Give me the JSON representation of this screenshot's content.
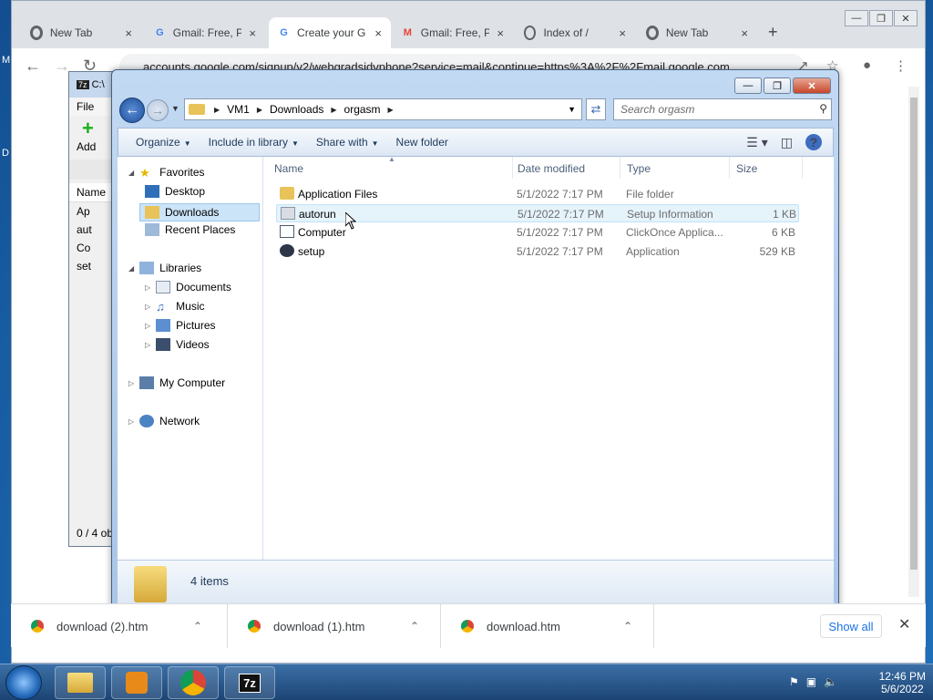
{
  "desktop": {
    "label_left_top": "M",
    "label_left_mid": "D"
  },
  "browser": {
    "tabs": [
      {
        "title": "New Tab",
        "icon": "chrome-icon"
      },
      {
        "title": "Gmail: Free, P",
        "icon": "google-icon"
      },
      {
        "title": "Create your G",
        "icon": "google-icon"
      },
      {
        "title": "Gmail: Free, P",
        "icon": "gmail-icon"
      },
      {
        "title": "Index of /",
        "icon": "globe-icon"
      },
      {
        "title": "New Tab",
        "icon": "chrome-icon"
      }
    ],
    "active_tab": 2,
    "new_tab_glyph": "+",
    "close_glyph": "×",
    "url": "accounts.google.com/signup/v2/webgradsidvphone?service=mail&continue=https%3A%2F%2Fmail.google.com"
  },
  "sevenzip": {
    "title": "C:\\",
    "menu_file": "File",
    "add_label": "Add",
    "col_name": "Name",
    "rows": [
      "Ap",
      "aut",
      "Co",
      "set"
    ],
    "status": "0 / 4 ob"
  },
  "explorer": {
    "breadcrumb": [
      "VM1",
      "Downloads",
      "orgasm"
    ],
    "search_placeholder": "Search orgasm",
    "commands": {
      "organize": "Organize",
      "include": "Include in library",
      "share": "Share with",
      "new_folder": "New folder"
    },
    "nav": {
      "favorites": "Favorites",
      "desktop": "Desktop",
      "downloads": "Downloads",
      "recent": "Recent Places",
      "libraries": "Libraries",
      "documents": "Documents",
      "music": "Music",
      "pictures": "Pictures",
      "videos": "Videos",
      "computer": "My Computer",
      "network": "Network"
    },
    "columns": {
      "name": "Name",
      "date": "Date modified",
      "type": "Type",
      "size": "Size"
    },
    "files": [
      {
        "name": "Application Files",
        "date": "5/1/2022 7:17 PM",
        "type": "File folder",
        "size": "",
        "icon": "folder-icon"
      },
      {
        "name": "autorun",
        "date": "5/1/2022 7:17 PM",
        "type": "Setup Information",
        "size": "1 KB",
        "icon": "setup-info-icon"
      },
      {
        "name": "Computer",
        "date": "5/1/2022 7:17 PM",
        "type": "ClickOnce Applica...",
        "size": "6 KB",
        "icon": "clickonce-icon"
      },
      {
        "name": "setup",
        "date": "5/1/2022 7:17 PM",
        "type": "Application",
        "size": "529 KB",
        "icon": "setup-app-icon"
      }
    ],
    "item_count": "4 items"
  },
  "downloads": [
    {
      "name": "download (2).htm"
    },
    {
      "name": "download (1).htm"
    },
    {
      "name": "download.htm"
    }
  ],
  "shelf": {
    "show_all": "Show all"
  },
  "taskbar": {
    "sevenzip_label": "7z",
    "time": "12:46 PM",
    "date": "5/6/2022"
  }
}
